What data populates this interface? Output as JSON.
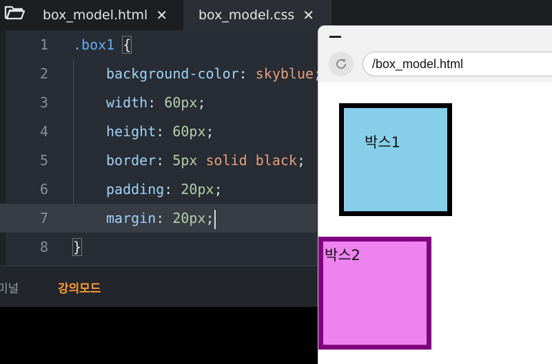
{
  "tabs": [
    {
      "label": "box_model.html",
      "close": "✕"
    },
    {
      "label": "box_model.css",
      "close": "✕"
    }
  ],
  "editor": {
    "line_numbers": [
      "1",
      "2",
      "3",
      "4",
      "5",
      "6",
      "7",
      "8"
    ],
    "lines": [
      {
        "selector": ".box1",
        "open": "{"
      },
      {
        "prop": "background-color",
        "colon": ":",
        "value": "skyblue",
        "semi": ";"
      },
      {
        "prop": "width",
        "colon": ":",
        "value": "60px",
        "semi": ";"
      },
      {
        "prop": "height",
        "colon": ":",
        "value": "60px",
        "semi": ";"
      },
      {
        "prop": "border",
        "colon": ":",
        "value_num": "5px",
        "value_kw": "solid black",
        "semi": ";"
      },
      {
        "prop": "padding",
        "colon": ":",
        "value": "20px",
        "semi": ";"
      },
      {
        "prop": "margin",
        "colon": ":",
        "value": "20px",
        "semi": ";"
      },
      {
        "close": "}"
      }
    ],
    "active_line": 7
  },
  "panel": {
    "tabs": [
      "미널",
      "강의모드"
    ]
  },
  "browser": {
    "url": "/box_model.html",
    "box1": {
      "label": "박스1",
      "background": "#87ceeb",
      "border_color": "#000000"
    },
    "box2": {
      "label": "박스2",
      "background": "#ee82ee",
      "border_color": "#800080"
    }
  },
  "icons": [
    "folder-icon",
    "close-icon",
    "minimize-icon",
    "reload-icon"
  ],
  "colors": {
    "accent_panel": "#ff9d33",
    "selector": "#61afef",
    "property": "#9fd3f7",
    "number": "#b5cea8",
    "keyword": "#e5a07a"
  }
}
